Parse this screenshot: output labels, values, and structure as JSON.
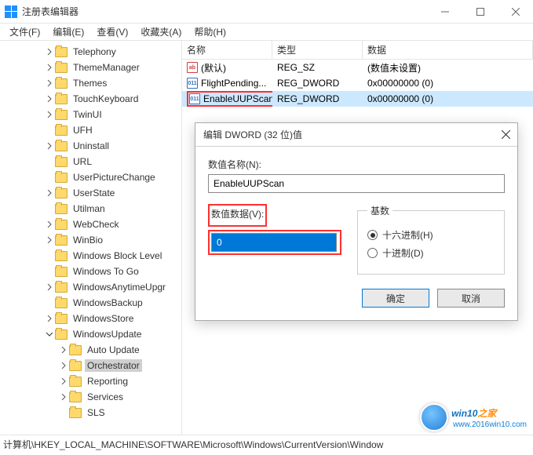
{
  "window": {
    "title": "注册表编辑器"
  },
  "menu": {
    "file": "文件(F)",
    "edit": "编辑(E)",
    "view": "查看(V)",
    "favorites": "收藏夹(A)",
    "help": "帮助(H)"
  },
  "tree": [
    {
      "indent": 56,
      "chev": "right",
      "label": "Telephony"
    },
    {
      "indent": 56,
      "chev": "right",
      "label": "ThemeManager"
    },
    {
      "indent": 56,
      "chev": "right",
      "label": "Themes"
    },
    {
      "indent": 56,
      "chev": "right",
      "label": "TouchKeyboard"
    },
    {
      "indent": 56,
      "chev": "right",
      "label": "TwinUI"
    },
    {
      "indent": 56,
      "chev": "none",
      "label": "UFH"
    },
    {
      "indent": 56,
      "chev": "right",
      "label": "Uninstall"
    },
    {
      "indent": 56,
      "chev": "none",
      "label": "URL"
    },
    {
      "indent": 56,
      "chev": "none",
      "label": "UserPictureChange"
    },
    {
      "indent": 56,
      "chev": "right",
      "label": "UserState"
    },
    {
      "indent": 56,
      "chev": "none",
      "label": "Utilman"
    },
    {
      "indent": 56,
      "chev": "right",
      "label": "WebCheck"
    },
    {
      "indent": 56,
      "chev": "right",
      "label": "WinBio"
    },
    {
      "indent": 56,
      "chev": "none",
      "label": "Windows Block Level"
    },
    {
      "indent": 56,
      "chev": "none",
      "label": "Windows To Go"
    },
    {
      "indent": 56,
      "chev": "right",
      "label": "WindowsAnytimeUpgr"
    },
    {
      "indent": 56,
      "chev": "none",
      "label": "WindowsBackup"
    },
    {
      "indent": 56,
      "chev": "right",
      "label": "WindowsStore"
    },
    {
      "indent": 56,
      "chev": "down",
      "label": "WindowsUpdate"
    },
    {
      "indent": 74,
      "chev": "right",
      "label": "Auto Update"
    },
    {
      "indent": 74,
      "chev": "right",
      "label": "Orchestrator",
      "selected": true
    },
    {
      "indent": 74,
      "chev": "right",
      "label": "Reporting"
    },
    {
      "indent": 74,
      "chev": "right",
      "label": "Services"
    },
    {
      "indent": 74,
      "chev": "none",
      "label": "SLS"
    }
  ],
  "list": {
    "cols": {
      "name": "名称",
      "type": "类型",
      "data": "数据"
    },
    "rows": [
      {
        "icon": "str",
        "name": "(默认)",
        "type": "REG_SZ",
        "data": "(数值未设置)"
      },
      {
        "icon": "dw",
        "name": "FlightPending...",
        "type": "REG_DWORD",
        "data": "0x00000000 (0)"
      },
      {
        "icon": "dw",
        "name": "EnableUUPScan",
        "type": "REG_DWORD",
        "data": "0x00000000 (0)",
        "selected": true,
        "highlight": true
      }
    ]
  },
  "dialog": {
    "title": "编辑 DWORD (32 位)值",
    "name_label": "数值名称(N):",
    "name_value": "EnableUUPScan",
    "data_label": "数值数据(V):",
    "data_value": "0",
    "base_label": "基数",
    "hex_label": "十六进制(H)",
    "dec_label": "十进制(D)",
    "ok": "确定",
    "cancel": "取消"
  },
  "statusbar": "计算机\\HKEY_LOCAL_MACHINE\\SOFTWARE\\Microsoft\\Windows\\CurrentVersion\\Window",
  "watermark": {
    "brand_a": "win10",
    "brand_b": "之家",
    "url": "www.2016win10.com"
  }
}
